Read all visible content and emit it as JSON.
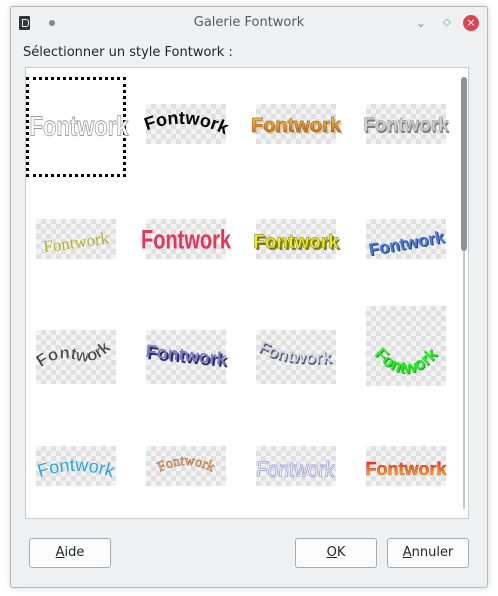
{
  "window": {
    "title": "Galerie Fontwork",
    "minimize_glyph": "⌄",
    "maximize_glyph": "◇",
    "close_glyph": "×"
  },
  "prompt": "Sélectionner un style Fontwork :",
  "gallery": {
    "sample_text": "Fontwork",
    "selected_index": 0,
    "items": [
      {
        "style": "outline-white"
      },
      {
        "style": "black-arched"
      },
      {
        "style": "gold-gradient-shadow"
      },
      {
        "style": "grey-3d"
      },
      {
        "style": "olive-serif-slanted"
      },
      {
        "style": "pink-perspective"
      },
      {
        "style": "yellow-3d"
      },
      {
        "style": "blue-slanted"
      },
      {
        "style": "grey-wave"
      },
      {
        "style": "purple-3d"
      },
      {
        "style": "silver-3d-wave"
      },
      {
        "style": "green-arch-bottom"
      },
      {
        "style": "cyan-arch"
      },
      {
        "style": "orange-outline-arch"
      },
      {
        "style": "lavender-outline"
      },
      {
        "style": "red-yellow-gradient"
      }
    ]
  },
  "buttons": {
    "help_mnemonic": "A",
    "help_rest": "ide",
    "ok_mnemonic": "O",
    "ok_rest": "K",
    "cancel_mnemonic": "A",
    "cancel_rest": "nnuler"
  },
  "colors": {
    "window_bg": "#eff0f1",
    "close_button": "#da4453",
    "scroll_thumb": "#8e9396"
  },
  "icons": {
    "app": "libreoffice-draw-icon",
    "minimize": "chevron-down-icon",
    "maximize": "diamond-icon",
    "close": "close-icon"
  }
}
